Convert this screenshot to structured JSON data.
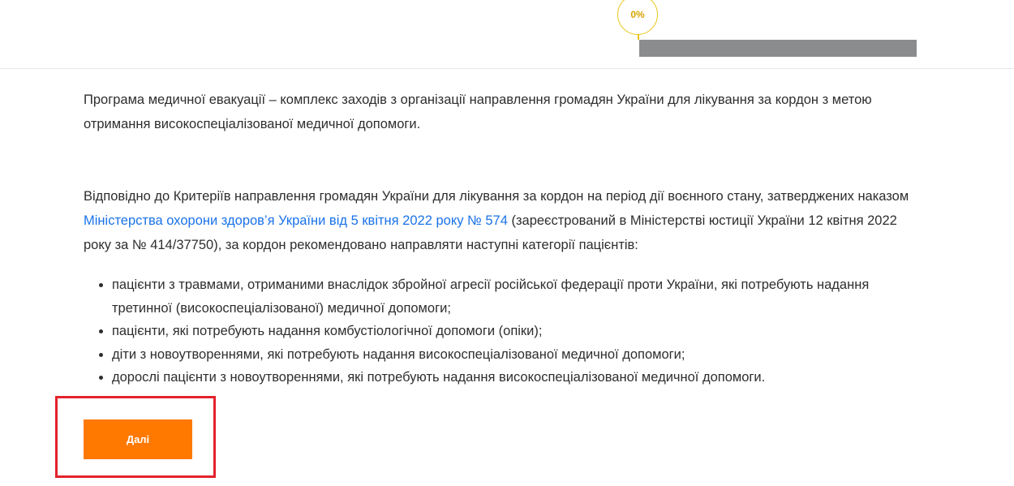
{
  "progress": {
    "label": "0%",
    "value": 0,
    "circle_color": "#e8c51a",
    "track_color": "#8a8c8e"
  },
  "intro": {
    "text": "Програма медичної евакуації – комплекс заходів з організації направлення громадян України для лікування за кордон з метою отримання високоспеціалізованої медичної допомоги."
  },
  "criteria": {
    "text_before_link": "Відповідно до Критеріїв направлення громадян України для лікування за кордон на період дії воєнного стану, затверджених наказом ",
    "link_text": "Міністерства охорони здоров’я України від 5 квітня 2022 року № 574",
    "text_after_link": " (зареєстрований в Міністерстві юстиції України 12 квітня 2022 року за № 414/37750), за кордон рекомендовано направляти наступні категорії пацієнтів:",
    "link_color": "#1a73e8"
  },
  "categories": [
    "пацієнти з травмами, отриманими внаслідок збройної агресії російської федерації проти України, які потребують надання третинної (високоспеціалізованої) медичної допомоги;",
    "пацієнти, які потребують надання комбустіологічної допомоги (опіки);",
    "діти з новоутвореннями, які потребують надання високоспеціалізованої медичної допомоги;",
    "дорослі пацієнти з новоутвореннями, які потребують надання високоспеціалізованої медичної допомоги."
  ],
  "actions": {
    "next_label": "Далі",
    "next_color": "#ff7900",
    "highlight_color": "#e3222b"
  }
}
